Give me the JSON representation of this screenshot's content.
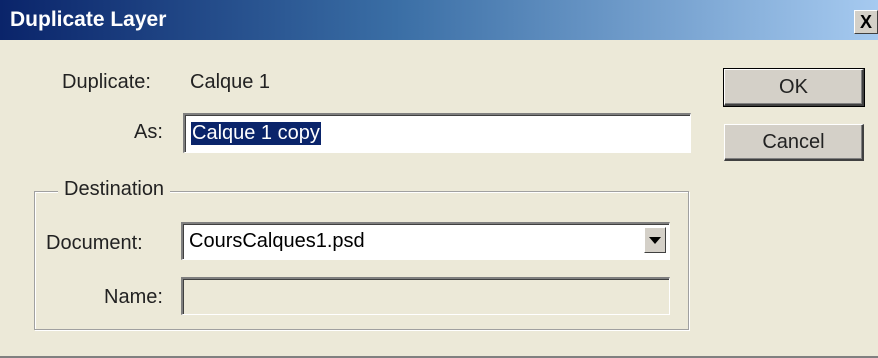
{
  "window": {
    "title": "Duplicate Layer",
    "close_glyph": "X"
  },
  "form": {
    "duplicate_label": "Duplicate:",
    "duplicate_value": "Calque 1",
    "as_label": "As:",
    "as_value": "Calque 1 copy"
  },
  "destination": {
    "legend": "Destination",
    "document_label": "Document:",
    "document_value": "CoursCalques1.psd",
    "name_label": "Name:",
    "name_value": ""
  },
  "buttons": {
    "ok_label": "OK",
    "cancel_label": "Cancel"
  },
  "colors": {
    "title_gradient_start": "#0a246a",
    "title_gradient_end": "#a6caf0",
    "dialog_bg": "#ece9d8",
    "selection_bg": "#0a246a"
  }
}
